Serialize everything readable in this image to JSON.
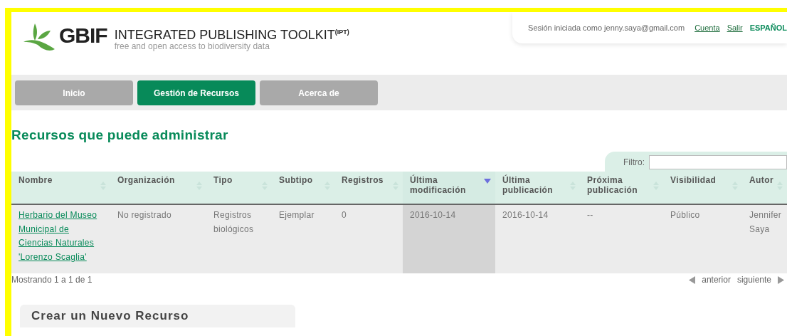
{
  "header": {
    "brand": "GBIF",
    "title": "INTEGRATED PUBLISHING TOOLKIT",
    "title_sup": "(IPT)",
    "tagline": "free and open access to biodiversity data"
  },
  "session": {
    "text": "Sesión iniciada como jenny.saya@gmail.com",
    "links": [
      "Cuenta",
      "Salir"
    ],
    "language": "ESPAÑOL"
  },
  "tabs": [
    {
      "label": "Inicio",
      "selected": false
    },
    {
      "label": "Gestión de Recursos",
      "selected": true
    },
    {
      "label": "Acerca de",
      "selected": false
    }
  ],
  "heading": "Recursos que puede administrar",
  "filter": {
    "label": "Filtro:"
  },
  "table": {
    "columns": [
      {
        "label": "Nombre",
        "sorted": false
      },
      {
        "label": "Organización",
        "sorted": false
      },
      {
        "label": "Tipo",
        "sorted": false
      },
      {
        "label": "Subtipo",
        "sorted": false
      },
      {
        "label": "Registros",
        "sorted": false
      },
      {
        "label": "Última modificación",
        "sorted": true
      },
      {
        "label": "Última publicación",
        "sorted": false
      },
      {
        "label": "Próxima publicación",
        "sorted": false
      },
      {
        "label": "Visibilidad",
        "sorted": false
      },
      {
        "label": "Autor",
        "sorted": false
      }
    ],
    "rows": [
      [
        "Herbario del Museo Municipal de Ciencias Naturales 'Lorenzo Scaglia'",
        "No registrado",
        "Registros biológicos",
        "Ejemplar",
        "0",
        "2016-10-14",
        "2016-10-14",
        "--",
        "Público",
        "Jennifer Saya"
      ]
    ]
  },
  "info": "Mostrando 1 a 1 de 1",
  "pager": {
    "previous": "anterior",
    "next": "siguiente"
  },
  "create_heading": "Crear un Nuevo Recurso"
}
